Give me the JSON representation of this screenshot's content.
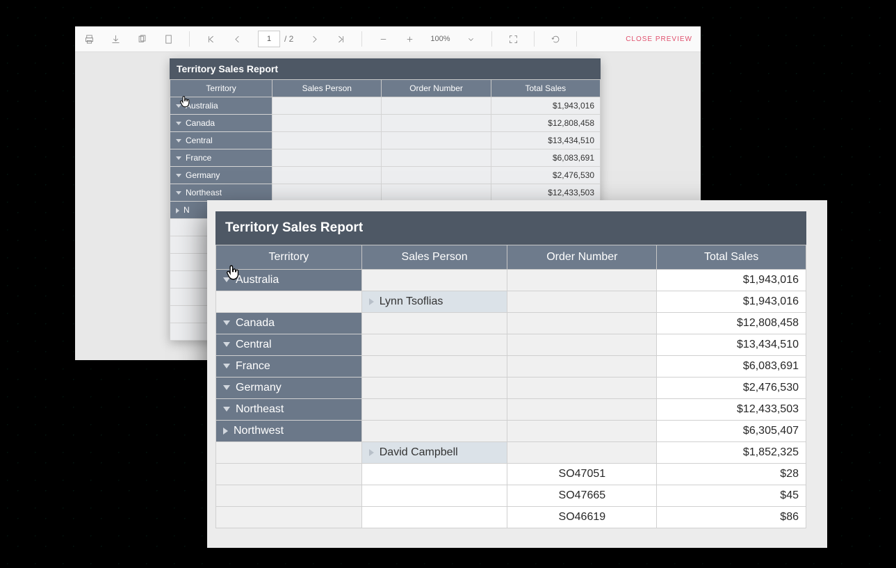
{
  "toolbar": {
    "page_current": "1",
    "page_total": "/ 2",
    "zoom": "100%",
    "close": "CLOSE PREVIEW"
  },
  "report": {
    "title": "Territory Sales Report",
    "headers": {
      "territory": "Territory",
      "person": "Sales Person",
      "order": "Order Number",
      "total": "Total Sales"
    }
  },
  "back_rows": [
    {
      "territory": "Australia",
      "total": "$1,943,016"
    },
    {
      "territory": "Canada",
      "total": "$12,808,458"
    },
    {
      "territory": "Central",
      "total": "$13,434,510"
    },
    {
      "territory": "France",
      "total": "$6,083,691"
    },
    {
      "territory": "Germany",
      "total": "$2,476,530"
    },
    {
      "territory": "Northeast",
      "total": "$12,433,503"
    }
  ],
  "back_partial": "N",
  "front_rows": {
    "australia": {
      "name": "Australia",
      "total": "$1,943,016"
    },
    "lynn": {
      "name": "Lynn Tsoflias",
      "total": "$1,943,016"
    },
    "canada": {
      "name": "Canada",
      "total": "$12,808,458"
    },
    "central": {
      "name": "Central",
      "total": "$13,434,510"
    },
    "france": {
      "name": "France",
      "total": "$6,083,691"
    },
    "germany": {
      "name": "Germany",
      "total": "$2,476,530"
    },
    "northeast": {
      "name": "Northeast",
      "total": "$12,433,503"
    },
    "northwest": {
      "name": "Northwest",
      "total": "$6,305,407"
    },
    "david": {
      "name": "David Campbell",
      "total": "$1,852,325"
    },
    "o1": {
      "order": "SO47051",
      "total": "$28"
    },
    "o2": {
      "order": "SO47665",
      "total": "$45"
    },
    "o3": {
      "order": "SO46619",
      "total": "$86"
    }
  }
}
